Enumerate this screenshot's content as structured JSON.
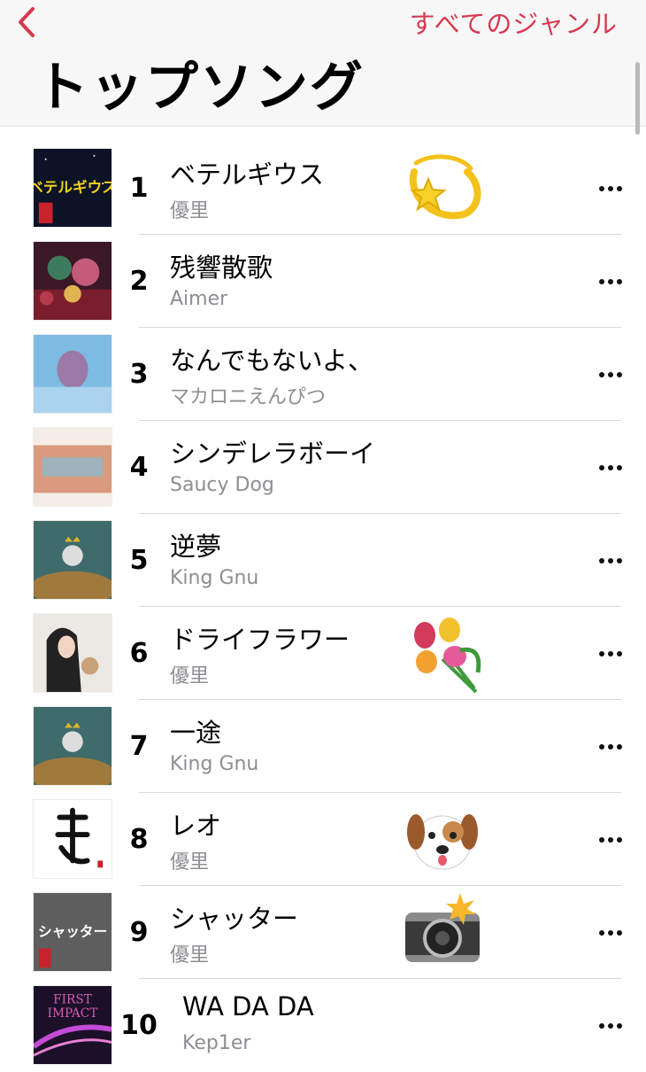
{
  "header": {
    "back_icon": "chevron-left-icon",
    "all_genres": "すべてのジャンル",
    "title": "トップソング"
  },
  "colors": {
    "accent": "#d6394f",
    "secondary_text": "#8e8e93",
    "separator": "#d9d9d9"
  },
  "songs": [
    {
      "rank": "1",
      "title": "ベテルギウス",
      "artist": "優里",
      "emoji": "dizzy-star-emoji"
    },
    {
      "rank": "2",
      "title": "残響散歌",
      "artist": "Aimer",
      "emoji": ""
    },
    {
      "rank": "3",
      "title": "なんでもないよ、",
      "artist": "マカロニえんぴつ",
      "emoji": ""
    },
    {
      "rank": "4",
      "title": "シンデレラボーイ",
      "artist": "Saucy Dog",
      "emoji": ""
    },
    {
      "rank": "5",
      "title": "逆夢",
      "artist": "King Gnu",
      "emoji": ""
    },
    {
      "rank": "6",
      "title": "ドライフラワー",
      "artist": "優里",
      "emoji": "bouquet-emoji"
    },
    {
      "rank": "7",
      "title": "一途",
      "artist": "King Gnu",
      "emoji": ""
    },
    {
      "rank": "8",
      "title": "レオ",
      "artist": "優里",
      "emoji": "dog-face-emoji"
    },
    {
      "rank": "9",
      "title": "シャッター",
      "artist": "優里",
      "emoji": "camera-flash-emoji"
    },
    {
      "rank": "10",
      "title": "WA DA DA",
      "artist": "Kep1er",
      "emoji": ""
    }
  ],
  "artwork_text": {
    "song1": "ベテルギウス",
    "song9": "シャッター",
    "song10": [
      "FIRST",
      "IMPACT"
    ]
  }
}
